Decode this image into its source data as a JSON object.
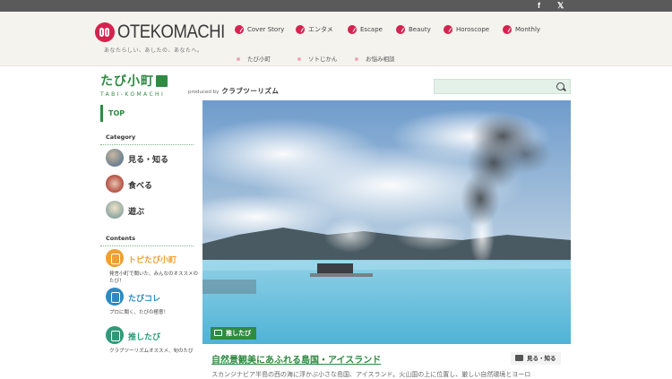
{
  "topbar": {
    "facebook": "f",
    "twitter": "🐦"
  },
  "header": {
    "logo_text": "OTEKOMACHI",
    "tagline": "あなたらしい、あしたの、あなたへ。",
    "nav": [
      {
        "label": "Cover Story"
      },
      {
        "label": "エンタメ"
      },
      {
        "label": "Escape"
      },
      {
        "label": "Beauty"
      },
      {
        "label": "Horoscope"
      },
      {
        "label": "Monthly"
      }
    ],
    "subnav": [
      {
        "label": "たび小町"
      },
      {
        "label": "ソトじかん"
      },
      {
        "label": "お悩み相談"
      }
    ]
  },
  "brand": {
    "name_jp": "たび小町",
    "name_en": "TABI-KOMACHI",
    "produced_by": "produced by",
    "producer": "クラブツーリズム"
  },
  "search": {
    "placeholder": ""
  },
  "sidebar": {
    "top_label": "TOP",
    "category_title": "Category",
    "categories": [
      {
        "label": "見る・知る"
      },
      {
        "label": "食べる"
      },
      {
        "label": "遊ぶ"
      }
    ],
    "contents_title": "Contents",
    "contents": [
      {
        "label": "トピたび小町",
        "desc": "発言小町で聞いた、みんなのオススメのたび！",
        "color": "#f0a030"
      },
      {
        "label": "たびコレ",
        "desc": "プロに聞く、たびの極意！",
        "color": "#2a8ac4"
      },
      {
        "label": "推したび",
        "desc": "クラブツーリズムオススメ、旬のたび",
        "color": "#2f9a78"
      }
    ]
  },
  "hero": {
    "tag": "推したび",
    "title": "自然景観美にあふれる島国・アイスランド",
    "category_badge": "見る・知る",
    "excerpt": "スカンジナビア半島の西の海に浮かぶ小さな島国、アイスランド。火山国の上に位置し、厳しい自然環境とヨーロ"
  },
  "colors": {
    "accent_green": "#2f8a42",
    "brand_red": "#d4234f"
  }
}
